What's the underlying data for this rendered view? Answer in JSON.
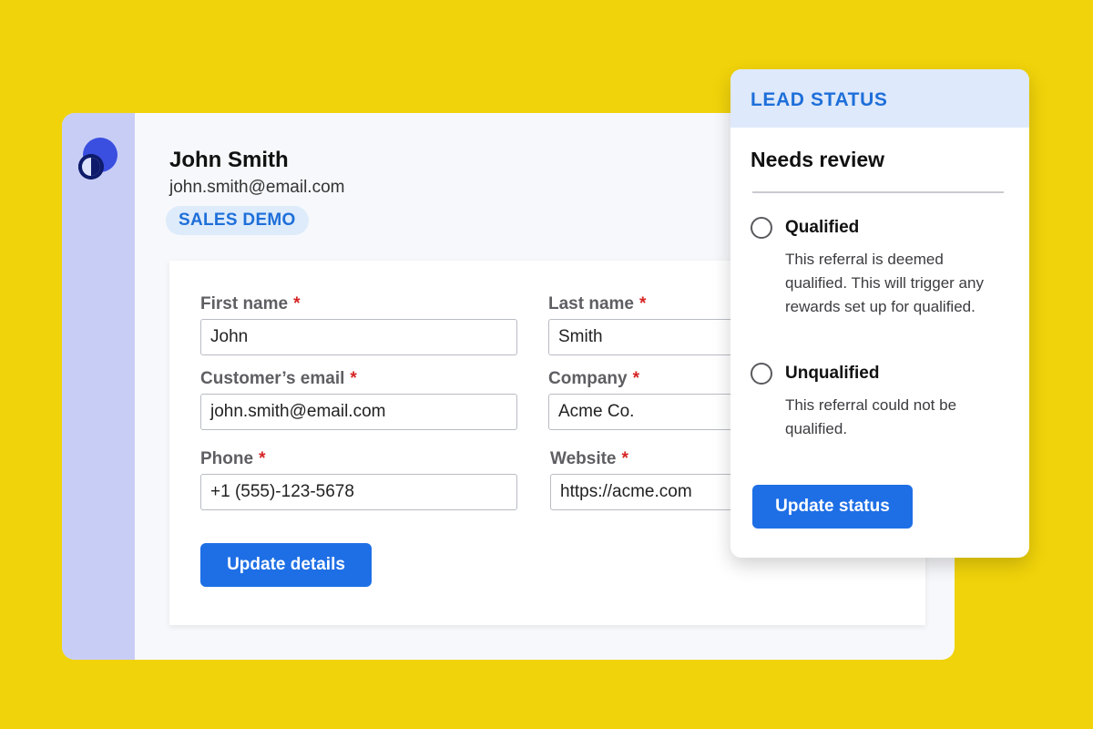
{
  "colors": {
    "background": "#F0D30A",
    "accent": "#1E6FE6",
    "sidebar": "#C8CDF6",
    "badge_bg": "#DDEBFB",
    "required": "#D62424"
  },
  "logo": {
    "icon": "app-logo-icon"
  },
  "contact": {
    "name": "John Smith",
    "email": "john.smith@email.com",
    "tag": "SALES DEMO"
  },
  "form": {
    "fields": [
      {
        "label": "First name",
        "required": "*",
        "value": "John"
      },
      {
        "label": "Last name",
        "required": "*",
        "value": "Smith"
      },
      {
        "label": "Customer’s email",
        "required": "*",
        "value": "john.smith@email.com"
      },
      {
        "label": "Company",
        "required": "*",
        "value": "Acme Co."
      },
      {
        "label": "Phone",
        "required": "*",
        "value": "+1 (555)-123-5678"
      },
      {
        "label": "Website",
        "required": "*",
        "value": "https://acme.com"
      }
    ],
    "submit_label": "Update details"
  },
  "lead_status": {
    "header": "LEAD STATUS",
    "current": "Needs review",
    "options": [
      {
        "title": "Qualified",
        "description": "This referral is deemed qualified. This will trigger any rewards set up for qualified."
      },
      {
        "title": "Unqualified",
        "description": "This referral could not be qualified."
      }
    ],
    "submit_label": "Update status"
  }
}
